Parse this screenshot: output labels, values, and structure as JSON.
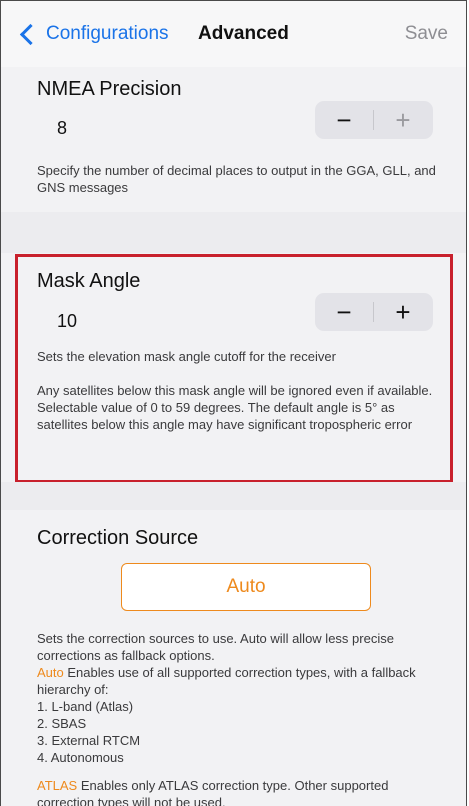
{
  "nav": {
    "back_label": "Configurations",
    "title": "Advanced",
    "save_label": "Save"
  },
  "nmea": {
    "heading": "NMEA Precision",
    "value": "8",
    "minus": "−",
    "plus": "+",
    "description": "Specify the number of decimal places to output in the GGA, GLL, and GNS messages"
  },
  "mask": {
    "heading": "Mask Angle",
    "value": "10",
    "minus": "−",
    "plus": "+",
    "description1": "Sets the elevation mask angle cutoff for the receiver",
    "description2": "Any satellites below this mask angle will be ignored even if available.  Selectable value of 0 to 59 degrees. The default angle is 5° as satellites below this angle may have significant tropospheric error"
  },
  "correction": {
    "heading": "Correction Source",
    "selected": "Auto",
    "intro": "Sets the correction sources to use. Auto will allow less precise corrections as fallback options.",
    "auto_keyword": "Auto",
    "auto_text": " Enables use of all supported correction types, with a fallback hierarchy of:",
    "hierarchy": [
      "1. L-band (Atlas)",
      "2. SBAS",
      "3. External RTCM",
      "4. Autonomous"
    ],
    "atlas_keyword": "ATLAS",
    "atlas_text": " Enables only ATLAS correction type. Other supported correction types will not be used."
  },
  "colors": {
    "accent_blue": "#1a73e8",
    "highlight_red": "#c8202c",
    "orange": "#ee8a1d"
  }
}
